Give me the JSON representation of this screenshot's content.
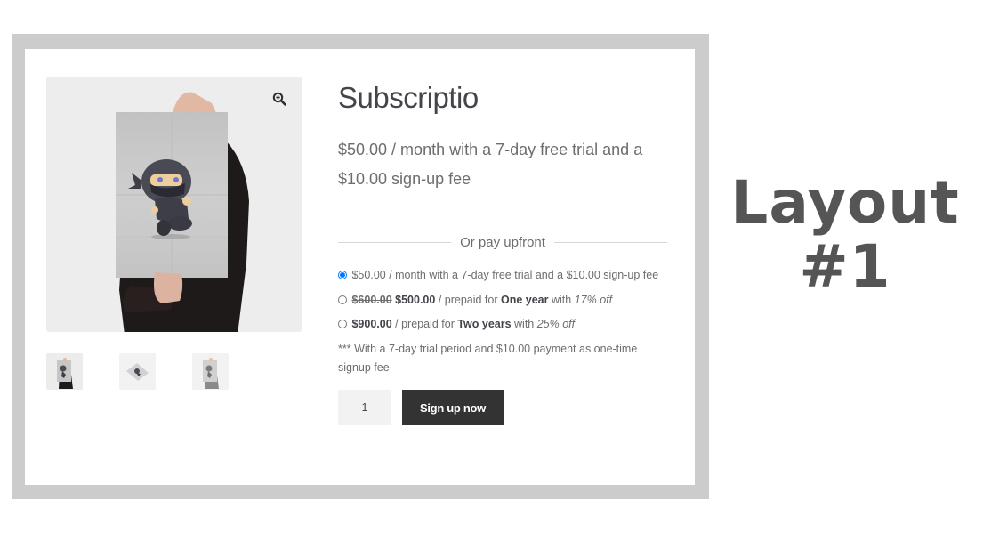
{
  "product": {
    "title": "Subscriptio",
    "price_text": "$50.00 / month with a 7-day free trial and a $10.00 sign-up fee"
  },
  "gallery": {
    "zoom_icon": "magnifier-plus-icon",
    "thumbnails": [
      {
        "alt": "Ninja poster held by person"
      },
      {
        "alt": "Ninja poster flat angled"
      },
      {
        "alt": "Ninja poster held by person grayscale"
      }
    ]
  },
  "upfront": {
    "divider_label": "Or pay upfront",
    "options": [
      {
        "selected": true,
        "label": "$50.00 / month with a 7-day free trial and a $10.00 sign-up fee"
      },
      {
        "selected": false,
        "old_price": "$600.00",
        "price": "$500.00",
        "mid_text": " / prepaid for ",
        "period": "One year",
        "with_text": " with ",
        "discount": "17% off"
      },
      {
        "selected": false,
        "price": "$900.00",
        "mid_text": " / prepaid for ",
        "period": "Two years",
        "with_text": " with ",
        "discount": "25% off"
      }
    ],
    "note": "*** With a 7-day trial period and $10.00 payment as one-time signup fee"
  },
  "cart": {
    "quantity": "1",
    "button_label": "Sign up now"
  },
  "side_label": {
    "line1": "Layout",
    "line2": "#1"
  },
  "colors": {
    "frame": "#cccccc",
    "button_bg": "#333333",
    "radio_accent": "#0075ff",
    "label_text": "#555555"
  }
}
